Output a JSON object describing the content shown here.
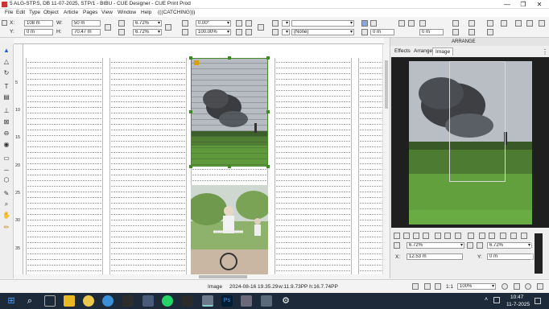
{
  "window": {
    "title": "5 ALG-STP.5, DB 11-07-2025, STP/1 - BIBU - CUE Designer - CUE Print Prod",
    "minimize": "—",
    "maximize": "❐",
    "close": "✕"
  },
  "menu": [
    "File",
    "Edit",
    "Type",
    "Object",
    "Article",
    "Pages",
    "View",
    "Window",
    "Help",
    "(((CATCHING)))"
  ],
  "toolbar": {
    "x_label": "X:",
    "x_value": "108 m",
    "y_label": "Y:",
    "y_value": "0 m",
    "w_label": "W:",
    "w_value": "50 m",
    "h_label": "H:",
    "h_value": "70.47 m",
    "scale_x": "6.72%",
    "scale_y": "6.72%",
    "angle": "0.00°",
    "percent": "100.00%",
    "style_value": "(None)",
    "offset_x": "0 m",
    "offset_y": "0 m"
  },
  "ruler_left_ticks": [
    "5",
    "10",
    "15",
    "20",
    "25",
    "30",
    "35"
  ],
  "panel": {
    "header": "ARRANGE",
    "tabs": [
      "Effects",
      "Arrange",
      "Image"
    ],
    "active_tab": "Image",
    "scale1": "6.72%",
    "scale2": "6.72%",
    "x_label": "X:",
    "x_value": "12.53 m",
    "y_label": "Y:",
    "y_value": "0 m"
  },
  "status": {
    "kind": "Image",
    "date": "2024-08-16 19.35.29",
    "dims": "w:11.9.73PP h:16.7.74PP",
    "ratio": "1:1",
    "zoom": "100%"
  },
  "taskbar": {
    "time": "10:47",
    "date": "11-7-2025"
  },
  "screenrec": "screenrec"
}
